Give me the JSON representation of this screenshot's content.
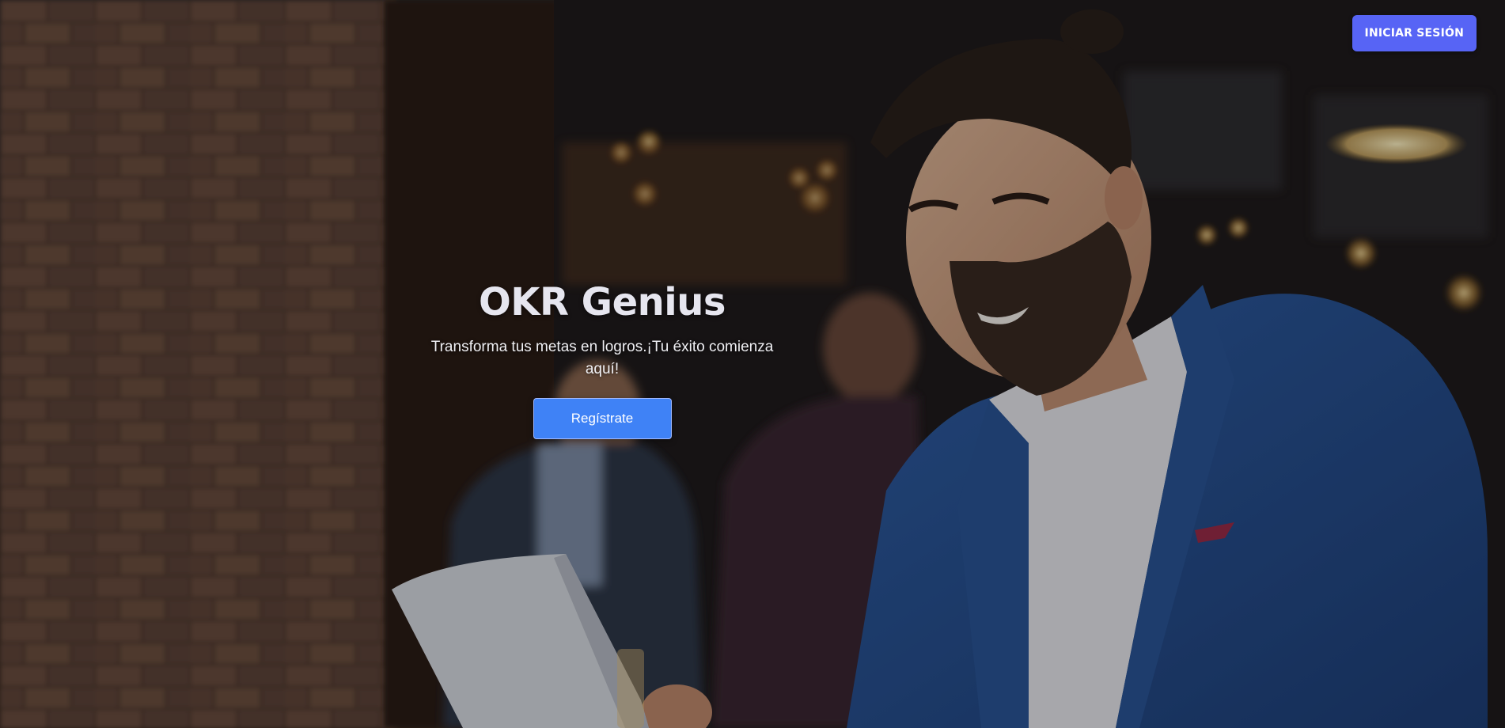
{
  "header": {
    "login_label": "INICIAR SESIÓN"
  },
  "hero": {
    "title": "OKR Genius",
    "subtitle": "Transforma tus metas en logros.¡Tu éxito comienza aquí!",
    "register_label": "Regístrate"
  },
  "colors": {
    "login_button": "#5764f5",
    "register_button": "#3f82f6"
  }
}
